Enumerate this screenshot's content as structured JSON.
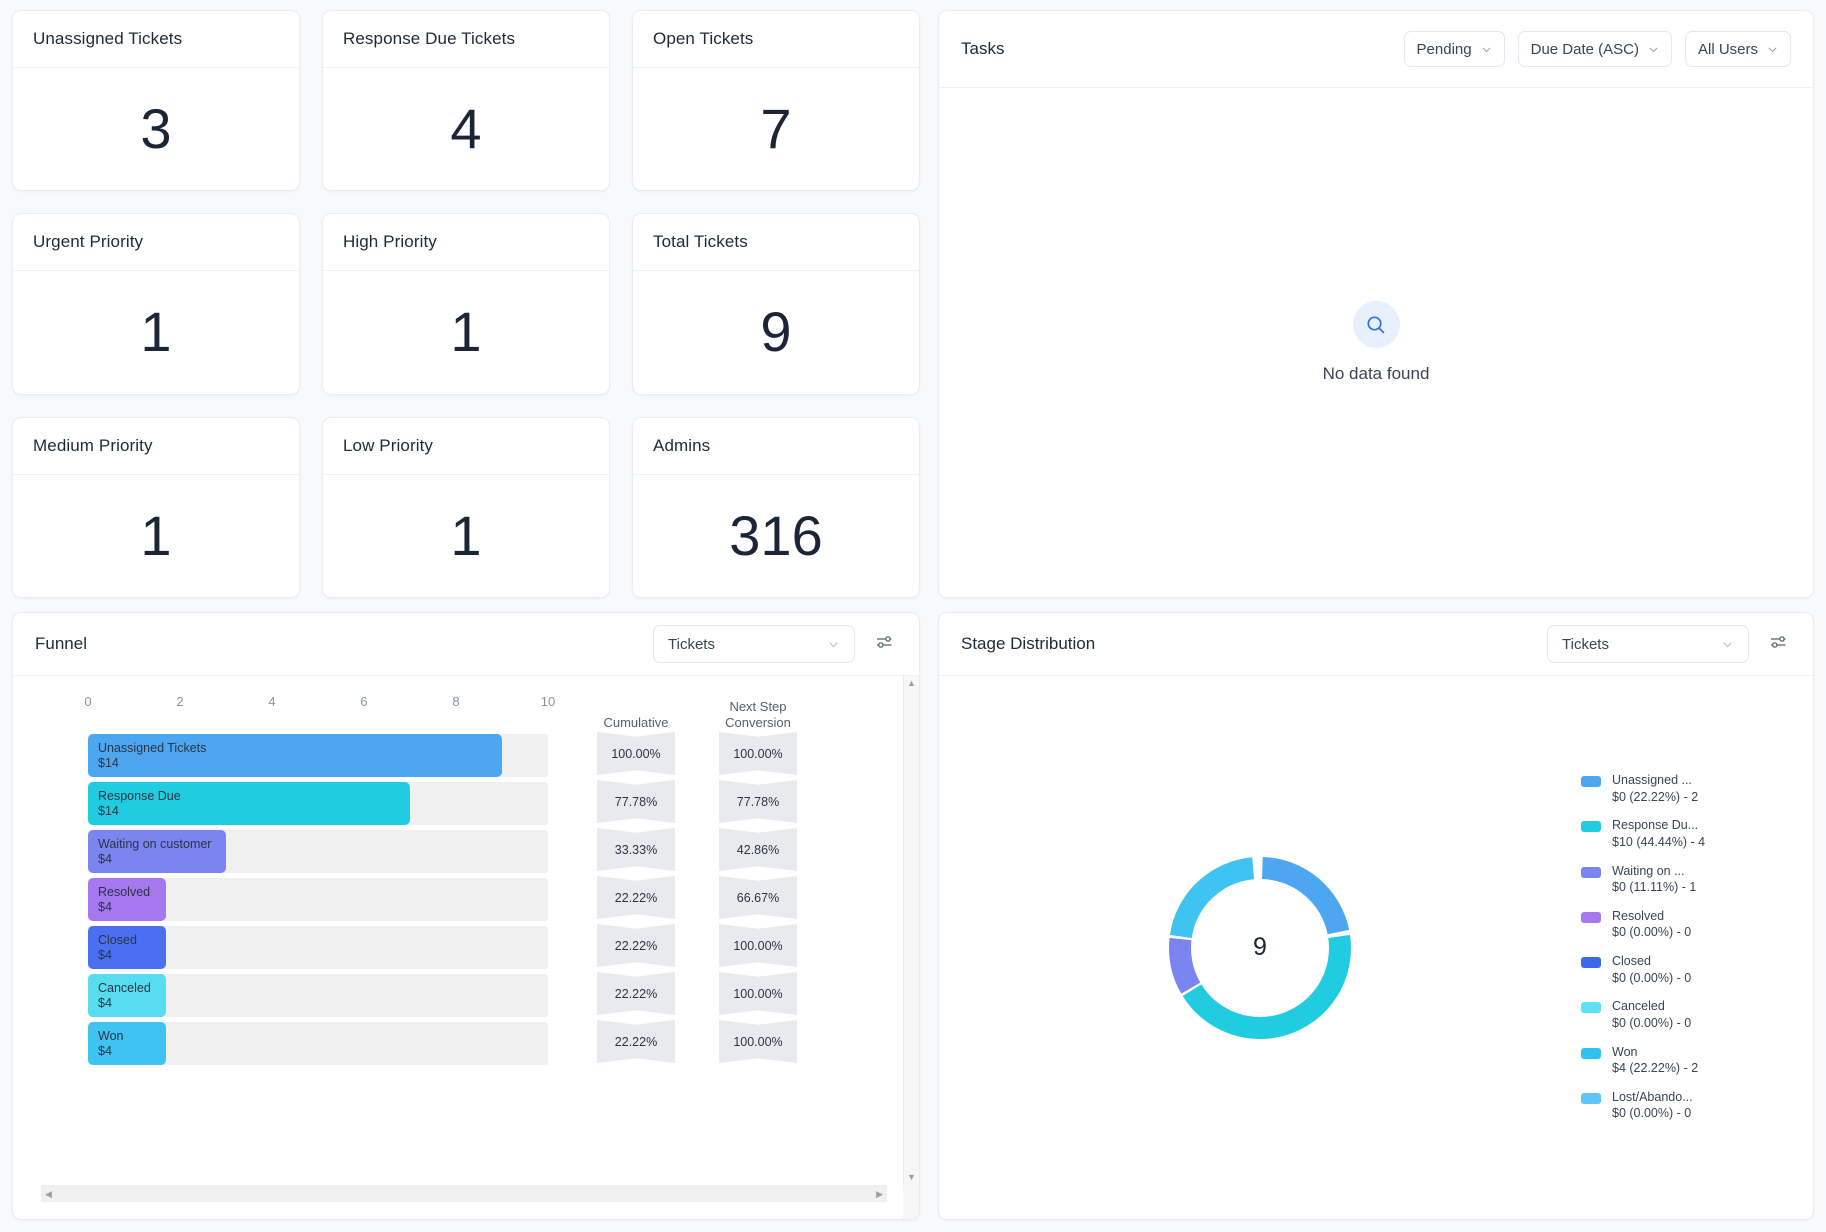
{
  "kpis": [
    {
      "label": "Unassigned Tickets",
      "value": "3"
    },
    {
      "label": "Response Due Tickets",
      "value": "4"
    },
    {
      "label": "Open Tickets",
      "value": "7"
    },
    {
      "label": "Urgent Priority",
      "value": "1"
    },
    {
      "label": "High Priority",
      "value": "1"
    },
    {
      "label": "Total Tickets",
      "value": "9"
    },
    {
      "label": "Medium Priority",
      "value": "1"
    },
    {
      "label": "Low Priority",
      "value": "1"
    },
    {
      "label": "Admins",
      "value": "316"
    }
  ],
  "tasks": {
    "title": "Tasks",
    "filters": [
      {
        "name": "status-filter",
        "value": "Pending"
      },
      {
        "name": "sort-filter",
        "value": "Due Date (ASC)"
      },
      {
        "name": "user-filter",
        "value": "All Users"
      }
    ],
    "empty_text": "No data found",
    "empty_icon": "search-icon"
  },
  "funnel": {
    "title": "Funnel",
    "source_select": "Tickets",
    "settings_icon": "sliders-icon",
    "col_headers": {
      "cumulative": "Cumulative",
      "next_step": "Next Step\nConversion"
    }
  },
  "stage": {
    "title": "Stage Distribution",
    "source_select": "Tickets",
    "settings_icon": "sliders-icon"
  },
  "chart_data": [
    {
      "type": "bar",
      "title": "Funnel",
      "orientation": "horizontal",
      "xlabel": "",
      "ylabel": "",
      "xlim": [
        0,
        10
      ],
      "ticks": [
        "0",
        "2",
        "4",
        "6",
        "8",
        "10"
      ],
      "grid": false,
      "categories": [
        "Unassigned Tickets",
        "Response Due",
        "Waiting on customer",
        "Resolved",
        "Closed",
        "Canceled",
        "Won"
      ],
      "values": [
        9,
        7,
        3,
        2,
        2,
        2,
        2
      ],
      "amounts": [
        "$14",
        "$14",
        "$4",
        "$4",
        "$4",
        "$4",
        "$4"
      ],
      "colors": [
        "#4da6f0",
        "#22cce0",
        "#7b84ef",
        "#a678ef",
        "#4a6ff0",
        "#57dcf0",
        "#3fc3f0"
      ],
      "cumulative": [
        "100.00%",
        "77.78%",
        "33.33%",
        "22.22%",
        "22.22%",
        "22.22%",
        "22.22%"
      ],
      "next_step_conversion": [
        "100.00%",
        "77.78%",
        "42.86%",
        "66.67%",
        "100.00%",
        "100.00%",
        "100.00%"
      ]
    },
    {
      "type": "pie",
      "variant": "donut",
      "title": "Stage Distribution",
      "center_label": "9",
      "legend_position": "right",
      "labels": [
        "Unassigned ...",
        "Response Du...",
        "Waiting on ...",
        "Resolved",
        "Closed",
        "Canceled",
        "Won",
        "Lost/Abando..."
      ],
      "values": [
        2,
        4,
        1,
        0,
        0,
        0,
        2,
        0
      ],
      "percents": [
        22.22,
        44.44,
        11.11,
        0.0,
        0.0,
        0.0,
        22.22,
        0.0
      ],
      "value_labels": [
        "$0 (22.22%) - 2",
        "$10 (44.44%) - 4",
        "$0 (11.11%) - 1",
        "$0 (0.00%) - 0",
        "$0 (0.00%) - 0",
        "$0 (0.00%) - 0",
        "$4 (22.22%) - 2",
        "$0 (0.00%) - 0"
      ],
      "colors": [
        "#4da6f0",
        "#22cce0",
        "#7b84ef",
        "#a678ef",
        "#3b6ae8",
        "#5ee0f5",
        "#2fc2ee",
        "#5ec6f7"
      ]
    }
  ]
}
